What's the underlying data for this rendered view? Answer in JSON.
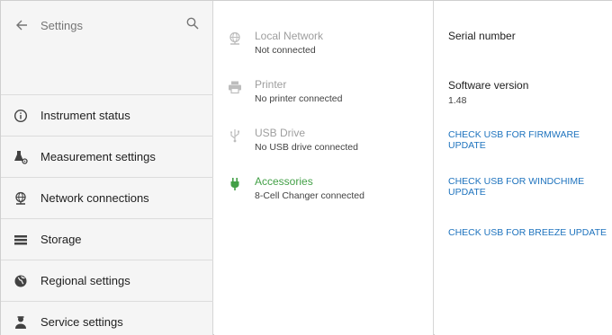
{
  "sidebar": {
    "title": "Settings",
    "items": [
      {
        "label": "Instrument status"
      },
      {
        "label": "Measurement settings"
      },
      {
        "label": "Network connections"
      },
      {
        "label": "Storage"
      },
      {
        "label": "Regional settings"
      },
      {
        "label": "Service settings"
      }
    ]
  },
  "connections": [
    {
      "title": "Local Network",
      "status": "Not connected",
      "icon": "globe-icon"
    },
    {
      "title": "Printer",
      "status": "No printer connected",
      "icon": "printer-icon"
    },
    {
      "title": "USB Drive",
      "status": "No USB drive connected",
      "icon": "usb-icon"
    },
    {
      "title": "Accessories",
      "status": "8-Cell Changer connected",
      "icon": "plug-icon"
    }
  ],
  "info": {
    "serial_label": "Serial number",
    "software_label": "Software version",
    "software_value": "1.48",
    "links": [
      "CHECK USB FOR FIRMWARE UPDATE",
      "CHECK USB FOR WINDCHIME UPDATE",
      "CHECK USB FOR BREEZE UPDATE"
    ]
  },
  "colors": {
    "accent_green": "#43a047",
    "link_blue": "#1e73be",
    "sidebar_bg": "#f5f5f5"
  }
}
